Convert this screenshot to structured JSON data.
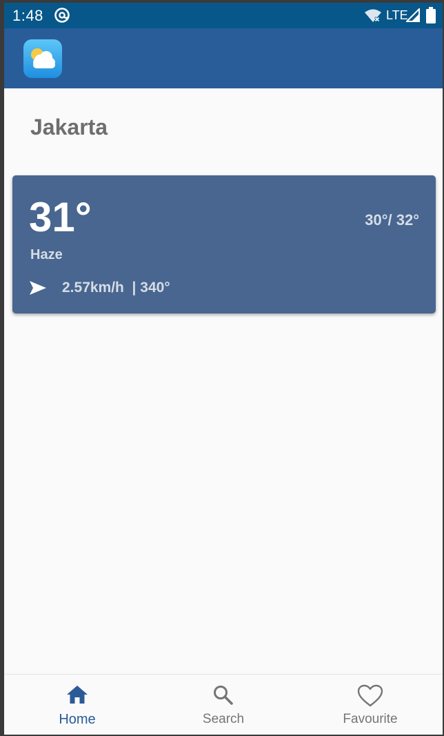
{
  "status_bar": {
    "time": "1:48",
    "network": "LTE"
  },
  "app_bar": {
    "logo_icon": "weather-partly-cloudy-icon"
  },
  "location": {
    "city": "Jakarta"
  },
  "weather": {
    "temperature": "31°",
    "min_max": "30°/ 32°",
    "condition": "Haze",
    "wind": "2.57km/h  | 340°",
    "wind_icon": "navigation-arrow-icon"
  },
  "bottom_nav": {
    "items": [
      {
        "label": "Home",
        "icon": "home-icon",
        "active": true
      },
      {
        "label": "Search",
        "icon": "search-icon",
        "active": false
      },
      {
        "label": "Favourite",
        "icon": "heart-icon",
        "active": false
      }
    ]
  },
  "colors": {
    "status_bar": "#08578a",
    "app_bar": "#285d9a",
    "card": "#48668f",
    "active_nav": "#2a5b97",
    "inactive_nav": "#757575"
  }
}
